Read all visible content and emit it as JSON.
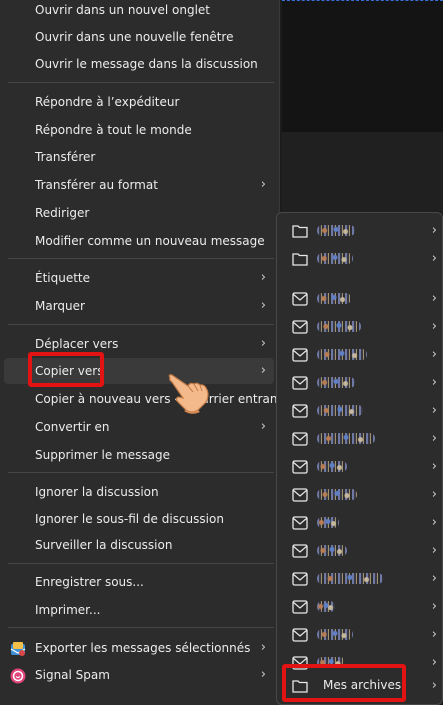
{
  "menu": {
    "items": [
      {
        "label": "Ouvrir dans un nouvel onglet",
        "submenu": false
      },
      {
        "label": "Ouvrir dans une nouvelle fenêtre",
        "submenu": false
      },
      {
        "label": "Ouvrir le message dans la discussion",
        "submenu": false
      },
      {
        "label": "Répondre à l’expéditeur",
        "submenu": false
      },
      {
        "label": "Répondre à tout le monde",
        "submenu": false
      },
      {
        "label": "Transférer",
        "submenu": false
      },
      {
        "label": "Transférer au format",
        "submenu": true
      },
      {
        "label": "Rediriger",
        "submenu": false
      },
      {
        "label": "Modifier comme un nouveau message",
        "submenu": false
      },
      {
        "label": "Étiquette",
        "submenu": true
      },
      {
        "label": "Marquer",
        "submenu": true
      },
      {
        "label": "Déplacer vers",
        "submenu": true
      },
      {
        "label": "Copier vers",
        "submenu": true,
        "highlighted": true
      },
      {
        "label": "Copier à nouveau vers « Courrier entrant »",
        "submenu": false
      },
      {
        "label": "Convertir en",
        "submenu": true
      },
      {
        "label": "Supprimer le message",
        "submenu": false
      },
      {
        "label": "Ignorer la discussion",
        "submenu": false
      },
      {
        "label": "Ignorer le sous-fil de discussion",
        "submenu": false
      },
      {
        "label": "Surveiller la discussion",
        "submenu": false
      },
      {
        "label": "Enregistrer sous...",
        "submenu": false
      },
      {
        "label": "Imprimer...",
        "submenu": false
      },
      {
        "label": "Exporter les messages sélectionnés",
        "submenu": true,
        "icon": "export-messages-icon"
      },
      {
        "label": "Signal Spam",
        "submenu": true,
        "icon": "signal-spam-icon"
      }
    ]
  },
  "submenu": {
    "folders": [
      {
        "icon": "folder-icon",
        "blurred": true
      },
      {
        "icon": "folder-icon",
        "blurred": true
      },
      {
        "icon": "account-folder-icon",
        "blurred": true
      },
      {
        "icon": "account-folder-icon",
        "blurred": true
      },
      {
        "icon": "account-folder-icon",
        "blurred": true
      },
      {
        "icon": "account-folder-icon",
        "blurred": true
      },
      {
        "icon": "account-folder-icon",
        "blurred": true
      },
      {
        "icon": "account-folder-icon",
        "blurred": true
      },
      {
        "icon": "account-folder-icon",
        "blurred": true
      },
      {
        "icon": "account-folder-icon",
        "blurred": true
      },
      {
        "icon": "account-folder-icon",
        "blurred": true
      },
      {
        "icon": "account-folder-icon",
        "blurred": true
      },
      {
        "icon": "account-folder-icon",
        "blurred": true
      },
      {
        "icon": "account-folder-icon",
        "blurred": true
      },
      {
        "icon": "account-folder-icon",
        "blurred": true
      },
      {
        "icon": "account-folder-icon",
        "blurred": true
      }
    ],
    "archives_label": "Mes archives"
  },
  "colors": {
    "highlight_border": "#e41313",
    "menu_bg": "#2c2c2c",
    "text": "#ececec"
  }
}
